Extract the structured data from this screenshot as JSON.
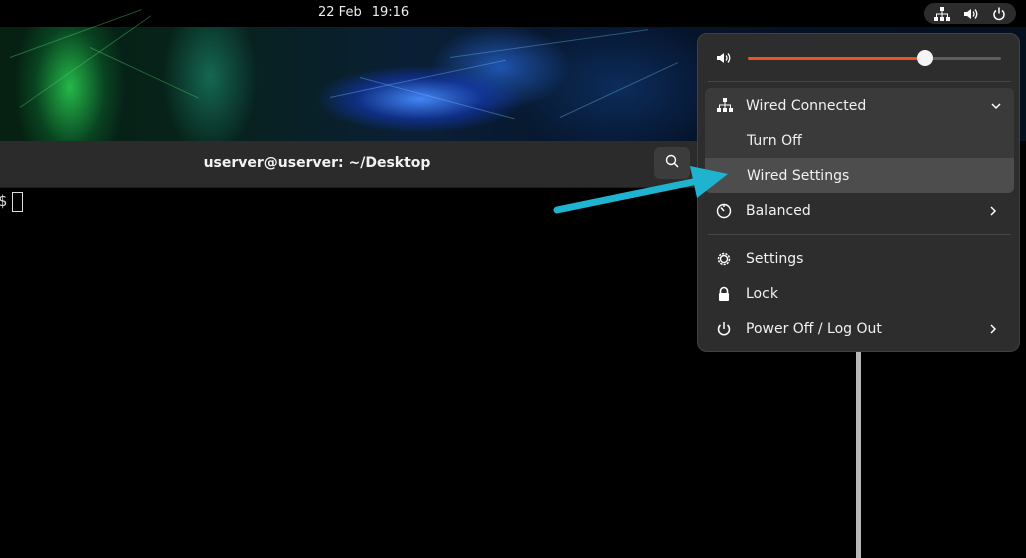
{
  "topbar": {
    "date": "22 Feb",
    "time": "19:16",
    "tray_icons": [
      "network-wired-icon",
      "volume-icon",
      "power-icon"
    ]
  },
  "terminal": {
    "title": "userver@userver: ~/Desktop",
    "prompt": "$"
  },
  "menu": {
    "volume_level": 0.7,
    "network": {
      "header": "Wired Connected",
      "items": [
        "Turn Off",
        "Wired Settings"
      ]
    },
    "power_mode": "Balanced",
    "items": [
      "Settings",
      "Lock",
      "Power Off / Log Out"
    ]
  },
  "colors": {
    "accent": "#e95420",
    "annotation_arrow": "#1fb3cf",
    "menu_bg": "#2d2d2d"
  }
}
